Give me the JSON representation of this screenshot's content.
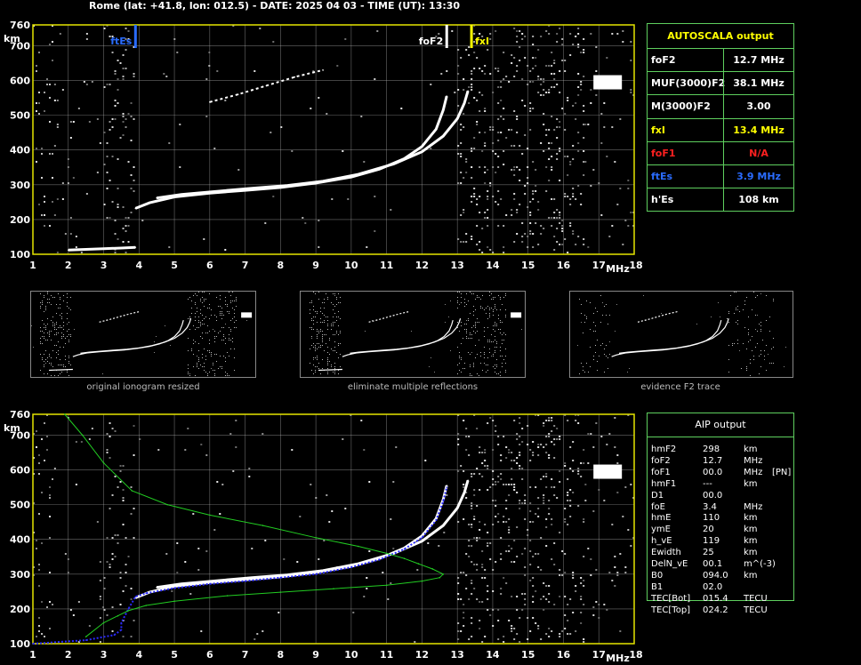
{
  "header": {
    "text": "Rome (lat: +41.8, lon: 012.5) - DATE: 2025 04 03 - TIME (UT): 13:30"
  },
  "colors": {
    "grid": "#c0c0c0",
    "frame": "#e6e600",
    "trace": "#ffffff",
    "profile": "#2a2aff",
    "green": "#22cc22",
    "tEs": "#2a6cff",
    "foF1": "#ff2020",
    "fxI": "#ffff00",
    "table_border": "#5ecf5e"
  },
  "chart_data": [
    {
      "type": "scatter",
      "title": "",
      "xlabel": "MHz",
      "ylabel": "km",
      "xlim": [
        1,
        18
      ],
      "ylim": [
        100,
        760
      ],
      "x_ticks": [
        "1",
        "2",
        "3",
        "4",
        "5",
        "6",
        "7",
        "8",
        "9",
        "10",
        "11",
        "12",
        "13",
        "14",
        "15",
        "16",
        "17",
        "18"
      ],
      "y_ticks": [
        "100",
        "200",
        "300",
        "400",
        "500",
        "600",
        "700",
        "760"
      ],
      "grid": true,
      "markers": [
        {
          "label": "ftEs",
          "x": 3.9
        },
        {
          "label": "foF2",
          "x": 12.7
        },
        {
          "label": "fxI",
          "x": 13.4
        }
      ],
      "series": [
        {
          "x": [
            2.0,
            2.5,
            3.0,
            3.5,
            3.9
          ],
          "y": [
            112,
            114,
            116,
            118,
            120
          ]
        },
        {
          "x": [
            3.9,
            4.3,
            5,
            6,
            7,
            8,
            9,
            10,
            10.8,
            11.5,
            12.0,
            12.4,
            12.6,
            12.7
          ],
          "y": [
            232,
            248,
            265,
            276,
            284,
            292,
            305,
            322,
            345,
            375,
            410,
            460,
            515,
            555
          ]
        },
        {
          "x": [
            4.5,
            5.2,
            6.2,
            7.2,
            8.2,
            9.2,
            10.2,
            11.2,
            12.0,
            12.6,
            13.0,
            13.2,
            13.3
          ],
          "y": [
            262,
            272,
            281,
            290,
            298,
            310,
            330,
            360,
            395,
            440,
            490,
            535,
            570
          ]
        },
        {
          "x": [
            6.0,
            6.8,
            7.6,
            8.4,
            9.2
          ],
          "y": [
            538,
            560,
            585,
            610,
            630
          ]
        }
      ]
    },
    {
      "type": "scatter",
      "title": "",
      "xlabel": "MHz",
      "ylabel": "km",
      "xlim": [
        1,
        18
      ],
      "ylim": [
        100,
        760
      ],
      "x_ticks": [
        "1",
        "2",
        "3",
        "4",
        "5",
        "6",
        "7",
        "8",
        "9",
        "10",
        "11",
        "12",
        "13",
        "14",
        "15",
        "16",
        "17",
        "18"
      ],
      "y_ticks": [
        "100",
        "200",
        "300",
        "400",
        "500",
        "600",
        "700",
        "760"
      ],
      "grid": true,
      "series": [
        {
          "x": [
            3.9,
            4.3,
            5,
            6,
            7,
            8,
            9,
            10,
            10.8,
            11.5,
            12.0,
            12.4,
            12.6,
            12.7
          ],
          "y": [
            232,
            248,
            265,
            276,
            284,
            292,
            305,
            322,
            345,
            375,
            410,
            460,
            515,
            555
          ]
        },
        {
          "x": [
            4.5,
            5.2,
            6.2,
            7.2,
            8.2,
            9.2,
            10.2,
            11.2,
            12.0,
            12.6,
            13.0,
            13.2,
            13.3
          ],
          "y": [
            262,
            272,
            281,
            290,
            298,
            310,
            330,
            360,
            395,
            440,
            490,
            535,
            570
          ]
        },
        {
          "x": [
            1.0,
            2.5,
            3.3,
            3.5,
            3.5,
            3.7,
            3.9,
            4.2,
            5,
            6,
            7,
            8,
            9,
            10,
            10.8,
            11.5,
            12.0,
            12.4,
            12.6,
            12.7
          ],
          "y": [
            100,
            110,
            125,
            140,
            160,
            200,
            235,
            245,
            260,
            272,
            280,
            290,
            300,
            320,
            342,
            372,
            405,
            455,
            510,
            550
          ]
        },
        {
          "x": [
            1.9,
            2.4,
            3.0,
            3.8,
            4.8,
            6,
            7.5,
            9,
            10.2,
            11.0,
            11.5,
            11.9,
            12.3,
            12.6,
            12.5,
            12.0,
            11.0,
            9.5,
            8.0,
            6.5,
            5.0,
            4.2,
            3.7,
            3.4,
            3.0,
            2.5
          ],
          "y": [
            760,
            700,
            620,
            540,
            500,
            470,
            440,
            405,
            380,
            360,
            345,
            330,
            315,
            300,
            290,
            280,
            268,
            258,
            248,
            238,
            222,
            210,
            195,
            180,
            160,
            120
          ]
        }
      ]
    }
  ],
  "autoscala": {
    "title": "AUTOSCALA output",
    "rows": [
      {
        "label": "foF2",
        "value": "12.7 MHz",
        "color": "#ffffff"
      },
      {
        "label": "MUF(3000)F2",
        "value": "38.1 MHz",
        "color": "#ffffff"
      },
      {
        "label": "M(3000)F2",
        "value": "3.00",
        "color": "#ffffff"
      },
      {
        "label": "fxI",
        "value": "13.4 MHz",
        "color": "#ffff00"
      },
      {
        "label": "foF1",
        "value": "N/A",
        "color": "#ff2020"
      },
      {
        "label": "ftEs",
        "value": "3.9 MHz",
        "color": "#2a6cff"
      },
      {
        "label": "h'Es",
        "value": "108     km",
        "color": "#ffffff"
      }
    ]
  },
  "thumbnails": [
    {
      "caption": "original ionogram resized"
    },
    {
      "caption": "eliminate multiple reflections"
    },
    {
      "caption": "evidence F2 trace"
    }
  ],
  "aip": {
    "title": "AIP output",
    "rows": [
      {
        "name": "hmF2",
        "value": "298",
        "unit": "km",
        "extra": ""
      },
      {
        "name": "foF2",
        "value": "12.7",
        "unit": "MHz",
        "extra": ""
      },
      {
        "name": "foF1",
        "value": "00.0",
        "unit": "MHz",
        "extra": "[PN]"
      },
      {
        "name": "hmF1",
        "value": "---",
        "unit": "km",
        "extra": ""
      },
      {
        "name": "D1",
        "value": "00.0",
        "unit": "",
        "extra": ""
      },
      {
        "name": "foE",
        "value": "3.4",
        "unit": "MHz",
        "extra": ""
      },
      {
        "name": "hmE",
        "value": "110",
        "unit": "km",
        "extra": ""
      },
      {
        "name": "ymE",
        "value": "20",
        "unit": "km",
        "extra": ""
      },
      {
        "name": "h_vE",
        "value": "119",
        "unit": "km",
        "extra": ""
      },
      {
        "name": "Ewidth",
        "value": "25",
        "unit": "km",
        "extra": ""
      },
      {
        "name": "DelN_vE",
        "value": "00.1",
        "unit": "m^(-3)",
        "extra": ""
      },
      {
        "name": "B0",
        "value": "094.0",
        "unit": "km",
        "extra": ""
      },
      {
        "name": "B1",
        "value": "02.0",
        "unit": "",
        "extra": ""
      },
      {
        "name": "TEC[Bot]",
        "value": "015.4",
        "unit": "TECU",
        "extra": ""
      },
      {
        "name": "TEC[Top]",
        "value": "024.2",
        "unit": "TECU",
        "extra": ""
      }
    ]
  }
}
